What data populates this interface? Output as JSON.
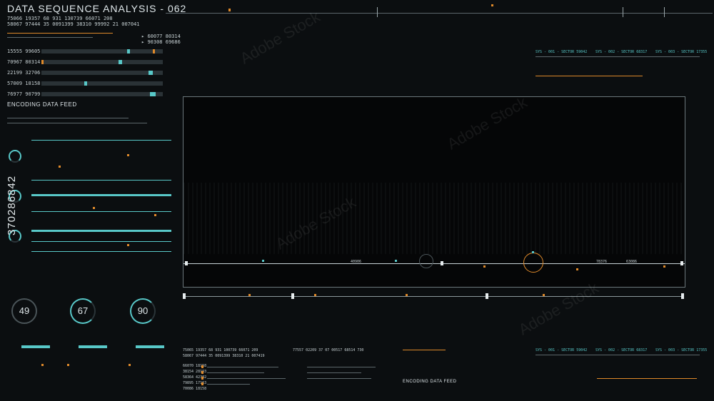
{
  "header": {
    "title": "DATA SEQUENCE ANALYSIS - 062",
    "code_row_1": [
      "75066",
      "19357",
      "68",
      "931",
      "130739",
      "66071",
      "208"
    ],
    "code_row_2": [
      "58067",
      "97444",
      "35",
      "0091399",
      "38310",
      "99992",
      "21",
      "007041"
    ],
    "right_codes": [
      "60077",
      "80314",
      "90308",
      "69686"
    ]
  },
  "left_rows": [
    {
      "code": "15555",
      "value": "99605"
    },
    {
      "code": "70967",
      "value": "80314"
    },
    {
      "code": "22199",
      "value": "32706"
    },
    {
      "code": "57009",
      "value": "18158"
    },
    {
      "code": "76977",
      "value": "90799"
    }
  ],
  "encoding": {
    "label": "ENCODING DATA FEED"
  },
  "gauges": [
    {
      "value": "49"
    },
    {
      "value": "67"
    },
    {
      "value": "90"
    }
  ],
  "sectors_top": [
    "SYS - 001 - SECTOR 59042",
    "SYS - 002 - SECTOR 68317",
    "SYS - 003 - SECTOR 17355"
  ],
  "sectors_bottom": [
    "SYS - 001 - SECTOR 59042",
    "SYS - 002 - SECTOR 68317",
    "SYS - 003 - SECTOR 17355"
  ],
  "bottom_center": {
    "encoding_label": "ENCODING DATA FEED",
    "codes_a": [
      "75065",
      "19357",
      "68",
      "931",
      "100739",
      "66071",
      "209"
    ],
    "codes_b": [
      "58067",
      "97444",
      "35",
      "0091399",
      "38310",
      "21",
      "007419"
    ],
    "codes_c": [
      "77557",
      "02209",
      "37",
      "07",
      "00517",
      "68514",
      "730"
    ],
    "list": [
      "66070 18158",
      "38154 28193",
      "58364 42302",
      "79895 17163",
      "70086 18158"
    ]
  },
  "main_readouts": {
    "center": "40906",
    "right": "78376",
    "right2": "63086"
  },
  "stock_id": "370286842",
  "watermark": "Adobe Stock",
  "colors": {
    "accent_cyan": "#58c8c8",
    "accent_orange": "#e08a2a",
    "background": "#0b0e10"
  }
}
